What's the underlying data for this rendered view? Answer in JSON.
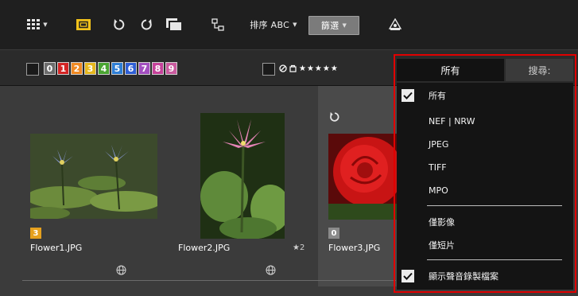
{
  "toolbar1": {
    "sort_label": "排序 ABC",
    "filter_label": "篩選"
  },
  "toolbar2": {
    "labels": [
      "0",
      "1",
      "2",
      "3",
      "4",
      "5",
      "6",
      "7",
      "8",
      "9"
    ],
    "label_colors": [
      "#6c6c6c",
      "#d32525",
      "#f08a24",
      "#e5b71e",
      "#4aa532",
      "#2f7fd6",
      "#2f5fd6",
      "#a34fc0",
      "#c6429a",
      "#c95a9e"
    ],
    "rating_stars": "★★★★★",
    "rating_reject_icon": "reject-icon",
    "rating_unrated_icon": "unrated-icon"
  },
  "dropdown": {
    "tab_all": "所有",
    "tab_search": "搜尋:",
    "items": [
      {
        "label": "所有",
        "checked": true
      },
      {
        "label": "NEF | NRW",
        "checked": false
      },
      {
        "label": "JPEG",
        "checked": false
      },
      {
        "label": "TIFF",
        "checked": false
      },
      {
        "label": "MPO",
        "checked": false
      },
      {
        "label": "僅影像",
        "checked": false
      },
      {
        "label": "僅短片",
        "checked": false
      },
      {
        "label": "顯示聲音錄製檔案",
        "checked": true
      }
    ]
  },
  "thumbnails": [
    {
      "filename": "Flower1.JPG",
      "label": "3",
      "label_color": "#e5a01e",
      "extra": ""
    },
    {
      "filename": "Flower2.JPG",
      "label": "",
      "label_color": "",
      "extra": "★2"
    },
    {
      "filename": "Flower3.JPG",
      "label": "0",
      "label_color": "#8a8a8a",
      "extra": ""
    }
  ],
  "colors": {
    "highlight_border": "#e00000",
    "toolbar_bg": "#1f1f1f",
    "content_bg": "#3b3b3b"
  }
}
